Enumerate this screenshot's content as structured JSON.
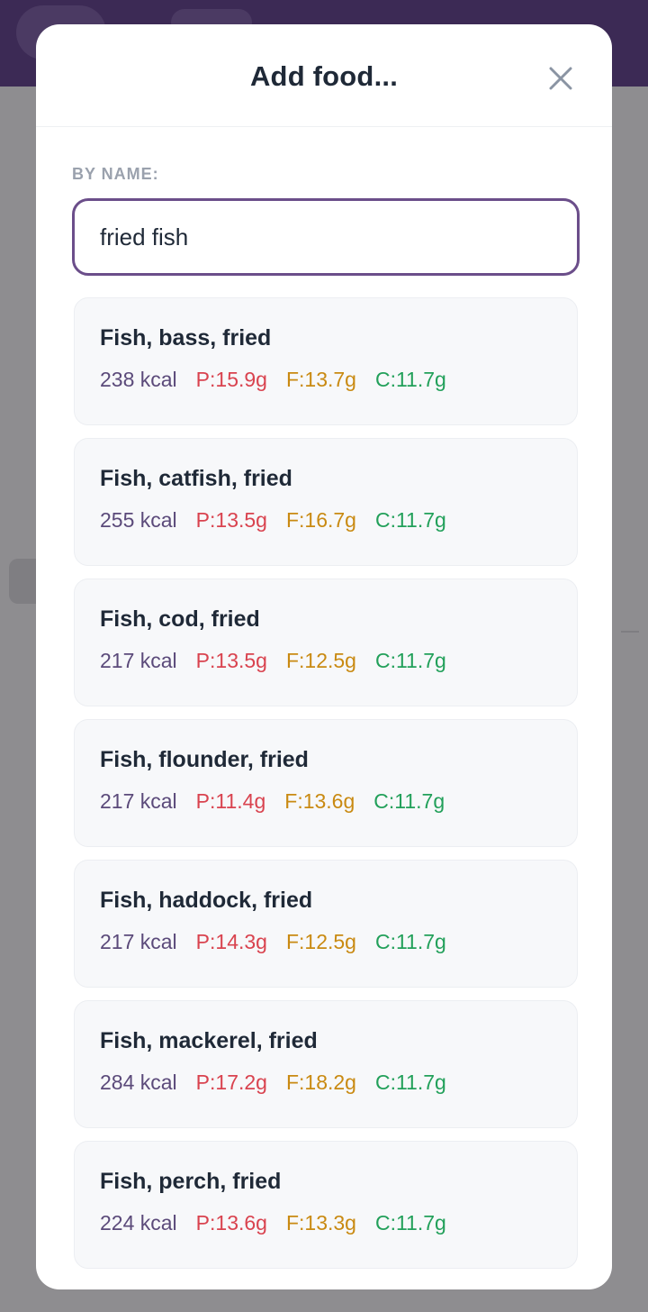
{
  "modal": {
    "title": "Add food...",
    "close_icon": "close-icon"
  },
  "search": {
    "label": "BY NAME:",
    "value": "fried fish"
  },
  "colors": {
    "accent": "#6b4e8a",
    "kcal": "#5b4a7a",
    "protein": "#d9434f",
    "fat": "#c98a12",
    "carbs": "#22a05a"
  },
  "results": [
    {
      "name": "Fish, bass, fried",
      "kcal": "238 kcal",
      "protein": "P:15.9g",
      "fat": "F:13.7g",
      "carbs": "C:11.7g"
    },
    {
      "name": "Fish, catfish, fried",
      "kcal": "255 kcal",
      "protein": "P:13.5g",
      "fat": "F:16.7g",
      "carbs": "C:11.7g"
    },
    {
      "name": "Fish, cod, fried",
      "kcal": "217 kcal",
      "protein": "P:13.5g",
      "fat": "F:12.5g",
      "carbs": "C:11.7g"
    },
    {
      "name": "Fish, flounder, fried",
      "kcal": "217 kcal",
      "protein": "P:11.4g",
      "fat": "F:13.6g",
      "carbs": "C:11.7g"
    },
    {
      "name": "Fish, haddock, fried",
      "kcal": "217 kcal",
      "protein": "P:14.3g",
      "fat": "F:12.5g",
      "carbs": "C:11.7g"
    },
    {
      "name": "Fish, mackerel, fried",
      "kcal": "284 kcal",
      "protein": "P:17.2g",
      "fat": "F:18.2g",
      "carbs": "C:11.7g"
    },
    {
      "name": "Fish, perch, fried",
      "kcal": "224 kcal",
      "protein": "P:13.6g",
      "fat": "F:13.3g",
      "carbs": "C:11.7g"
    }
  ]
}
